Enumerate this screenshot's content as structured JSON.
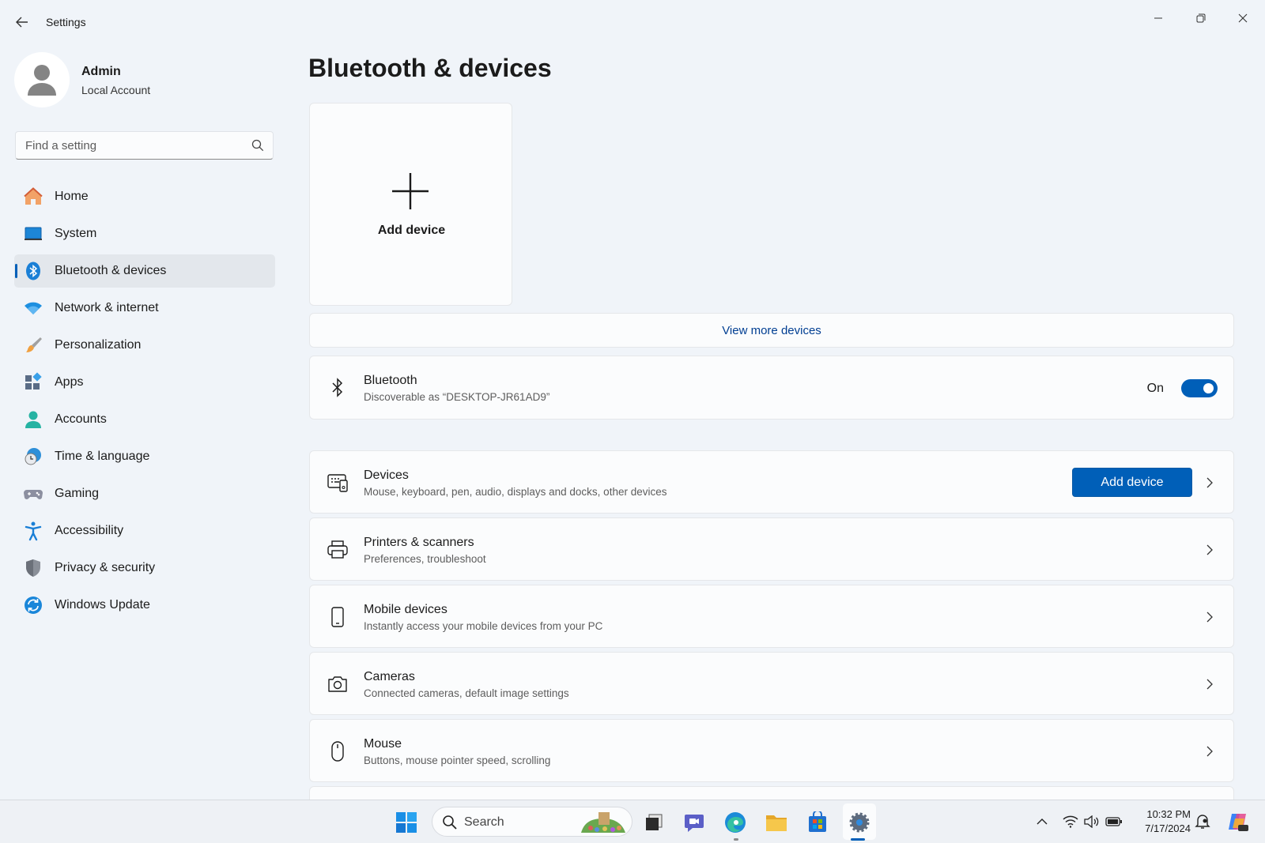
{
  "app": {
    "title": "Settings"
  },
  "profile": {
    "name": "Admin",
    "account_type": "Local Account"
  },
  "search": {
    "placeholder": "Find a setting"
  },
  "sidebar": {
    "items": [
      {
        "label": "Home",
        "icon": "home-icon"
      },
      {
        "label": "System",
        "icon": "system-icon"
      },
      {
        "label": "Bluetooth & devices",
        "icon": "bluetooth-icon",
        "selected": true
      },
      {
        "label": "Network & internet",
        "icon": "wifi-icon"
      },
      {
        "label": "Personalization",
        "icon": "brush-icon"
      },
      {
        "label": "Apps",
        "icon": "apps-icon"
      },
      {
        "label": "Accounts",
        "icon": "accounts-icon"
      },
      {
        "label": "Time & language",
        "icon": "clock-globe-icon"
      },
      {
        "label": "Gaming",
        "icon": "gamepad-icon"
      },
      {
        "label": "Accessibility",
        "icon": "accessibility-icon"
      },
      {
        "label": "Privacy & security",
        "icon": "shield-icon"
      },
      {
        "label": "Windows Update",
        "icon": "update-icon"
      }
    ]
  },
  "main": {
    "title": "Bluetooth & devices",
    "add_tile_label": "Add device",
    "view_more_label": "View more devices",
    "bluetooth": {
      "title": "Bluetooth",
      "subtitle": "Discoverable as “DESKTOP-JR61AD9”",
      "state_label": "On",
      "enabled": true
    },
    "devices": {
      "title": "Devices",
      "subtitle": "Mouse, keyboard, pen, audio, displays and docks, other devices",
      "button_label": "Add device"
    },
    "printers": {
      "title": "Printers & scanners",
      "subtitle": "Preferences, troubleshoot"
    },
    "mobile": {
      "title": "Mobile devices",
      "subtitle": "Instantly access your mobile devices from your PC"
    },
    "cameras": {
      "title": "Cameras",
      "subtitle": "Connected cameras, default image settings"
    },
    "mouse": {
      "title": "Mouse",
      "subtitle": "Buttons, mouse pointer speed, scrolling"
    }
  },
  "taskbar": {
    "search_label": "Search",
    "time": "10:32 PM",
    "date": "7/17/2024"
  },
  "colors": {
    "accent": "#005fb8",
    "background": "#f0f4f9",
    "card": "#fbfcfd"
  }
}
